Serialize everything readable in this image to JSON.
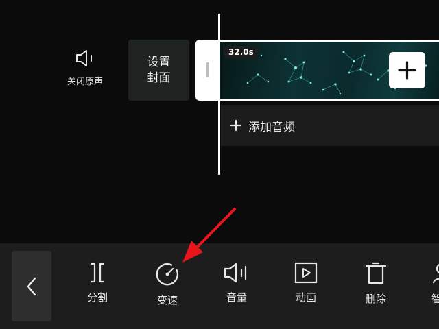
{
  "timeline": {
    "mute_label": "关闭原声",
    "cover_label_line1": "设置",
    "cover_label_line2": "封面",
    "clip_duration": "32.0s",
    "add_audio_label": "添加音频"
  },
  "toolbar": {
    "items": [
      {
        "label": "分割",
        "icon": "split-icon"
      },
      {
        "label": "变速",
        "icon": "speed-icon"
      },
      {
        "label": "音量",
        "icon": "volume-icon"
      },
      {
        "label": "动画",
        "icon": "animation-icon"
      },
      {
        "label": "删除",
        "icon": "delete-icon"
      },
      {
        "label": "智能",
        "icon": "smart-icon"
      }
    ]
  },
  "colors": {
    "background": "#0b0b0b",
    "toolbar": "#1d1d1d",
    "annotation_arrow": "#e8161b",
    "clip_teal": "#0d3234"
  }
}
